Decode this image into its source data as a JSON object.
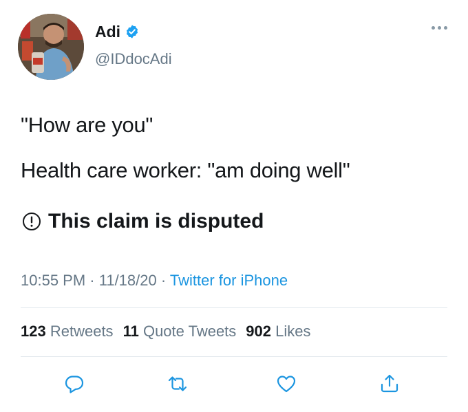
{
  "tweet": {
    "author": {
      "name": "Adi",
      "handle": "@IDdocAdi",
      "verified": true
    },
    "text_lines": [
      "\"How are you\"",
      "Health care worker: \"am doing well\""
    ],
    "label": "This claim is disputed",
    "time": "10:55 PM",
    "date": "11/18/20",
    "source": "Twitter for iPhone",
    "separator": " · ",
    "stats": {
      "retweets": {
        "count": "123",
        "label": "Retweets"
      },
      "quotes": {
        "count": "11",
        "label": "Quote Tweets"
      },
      "likes": {
        "count": "902",
        "label": "Likes"
      }
    }
  },
  "icons": {
    "verified": "verified-badge-icon",
    "more": "more-options-icon",
    "disputed": "exclamation-circle-icon",
    "reply": "reply-icon",
    "retweet": "retweet-icon",
    "like": "heart-icon",
    "share": "share-icon"
  },
  "colors": {
    "text": "#14171a",
    "secondary": "#657786",
    "link": "#1b95e0",
    "verified": "#1da1f2",
    "divider": "#e1e8ed",
    "icon": "#1b95e0"
  }
}
